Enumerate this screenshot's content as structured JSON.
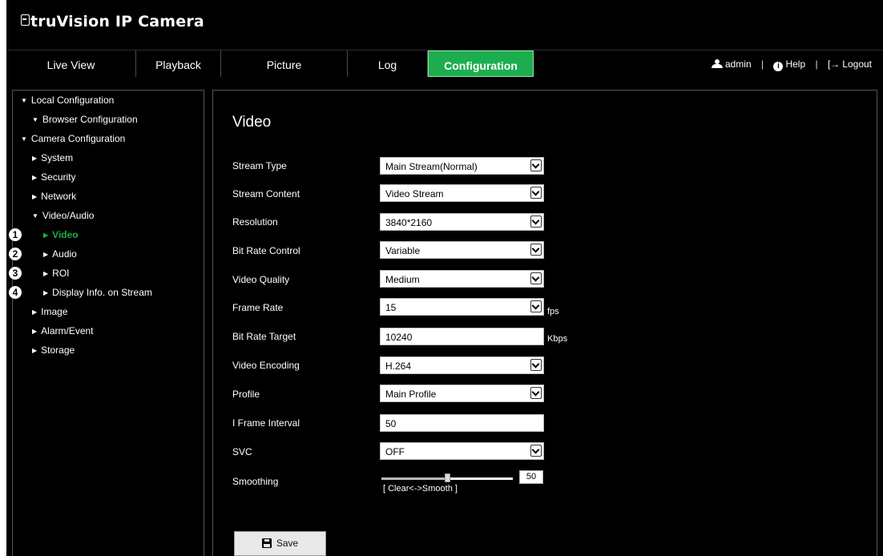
{
  "app": {
    "brand_prefix": "tru",
    "brand_rest": "Vision IP Camera"
  },
  "nav": {
    "tabs": [
      {
        "label": "Live View"
      },
      {
        "label": "Playback"
      },
      {
        "label": "Picture"
      },
      {
        "label": "Log"
      },
      {
        "label": "Configuration"
      }
    ],
    "active_tab": "Configuration",
    "user_label": "admin",
    "help_label": "Help",
    "logout_label": "Logout"
  },
  "sidebar": {
    "items": [
      {
        "label": "Local Configuration",
        "state": "expanded"
      },
      {
        "label": "Browser Configuration",
        "state": "expanded"
      },
      {
        "label": "Camera Configuration",
        "state": "expanded"
      },
      {
        "label": "System",
        "state": "collapsed"
      },
      {
        "label": "Security",
        "state": "collapsed"
      },
      {
        "label": "Network",
        "state": "collapsed"
      },
      {
        "label": "Video/Audio",
        "state": "expanded"
      },
      {
        "label": "Video",
        "state": "collapsed",
        "callout": "1"
      },
      {
        "label": "Audio",
        "state": "collapsed",
        "callout": "2"
      },
      {
        "label": "ROI",
        "state": "collapsed",
        "callout": "3"
      },
      {
        "label": "Display Info. on Stream",
        "state": "collapsed",
        "callout": "4"
      },
      {
        "label": "Image",
        "state": "collapsed"
      },
      {
        "label": "Alarm/Event",
        "state": "collapsed"
      },
      {
        "label": "Storage",
        "state": "collapsed"
      }
    ],
    "selected": "Video"
  },
  "main": {
    "title": "Video",
    "fields": [
      {
        "label": "Stream Type",
        "value": "Main Stream(Normal)",
        "kind": "select"
      },
      {
        "label": "Stream Content",
        "value": "Video Stream",
        "kind": "select"
      },
      {
        "label": "Resolution",
        "value": "3840*2160",
        "kind": "select"
      },
      {
        "label": "Bit Rate Control",
        "value": "Variable",
        "kind": "select"
      },
      {
        "label": "Video Quality",
        "value": "Medium",
        "kind": "select"
      },
      {
        "label": "Frame Rate",
        "value": "15",
        "kind": "select",
        "unit": "fps"
      },
      {
        "label": "Bit Rate Target",
        "value": "10240",
        "kind": "text",
        "unit": "Kbps"
      },
      {
        "label": "Video Encoding",
        "value": "H.264",
        "kind": "select"
      },
      {
        "label": "Profile",
        "value": "Main Profile",
        "kind": "select"
      },
      {
        "label": "I Frame Interval",
        "value": "50",
        "kind": "text"
      },
      {
        "label": "SVC",
        "value": "OFF",
        "kind": "select"
      }
    ],
    "smoothing": {
      "label": "Smoothing",
      "value": "50",
      "hint": "[ Clear<->Smooth ]",
      "slider_fraction": 0.5
    },
    "save_label": "Save"
  },
  "colors": {
    "accent": "#1cae4e",
    "background": "#000000",
    "field": "#ffffff"
  },
  "icons": [
    "user-icon",
    "help-icon",
    "logout-icon",
    "save-icon",
    "chevron-down-icon",
    "triangle-right-icon",
    "triangle-down-icon"
  ]
}
